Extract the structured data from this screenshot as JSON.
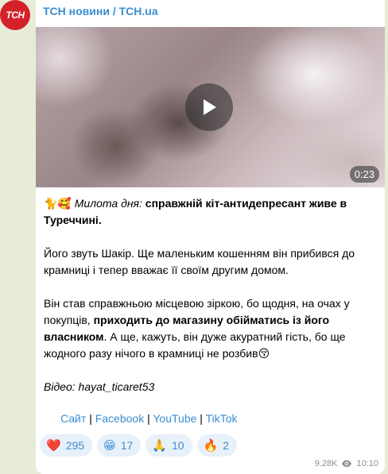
{
  "avatar": {
    "text": "ТСН"
  },
  "channel": {
    "name": "ТСН новини / TCH.ua"
  },
  "video": {
    "duration": "0:23"
  },
  "post": {
    "emoji_prefix": "🐈🥰",
    "lead_italic": "Милота дня:",
    "lead_bold": "справжній кіт-антидепресант живе в Туреччині.",
    "p2": "Його звуть Шакір. Ще маленьким кошенням він прибився до крамниці і тепер вважає її своїм другим домом.",
    "p3_a": "Він став справжньою місцевою зіркою, бо щодня, на очах у покупців,",
    "p3_bold": "приходить до магазину обійматись із його власником",
    "p3_b": ". А ще, кажуть, він дуже акуратний гість, бо ще жодного разу нічого в крамниці не розбив",
    "p3_emoji": "😚",
    "p4": "Відео: hayat_ticaret53"
  },
  "links": {
    "site": "Сайт",
    "sep": "|",
    "facebook": "Facebook",
    "youtube": "YouTube",
    "tiktok": "TikTok"
  },
  "reactions": [
    {
      "emoji": "❤️",
      "count": "295"
    },
    {
      "emoji": "😁",
      "count": "17"
    },
    {
      "emoji": "🙏",
      "count": "10"
    },
    {
      "emoji": "🔥",
      "count": "2"
    }
  ],
  "meta": {
    "views": "9.28K",
    "time": "10:10"
  },
  "colors": {
    "accent": "#3a8ed1",
    "brand": "#d3222a",
    "background": "#e7ecd8"
  }
}
